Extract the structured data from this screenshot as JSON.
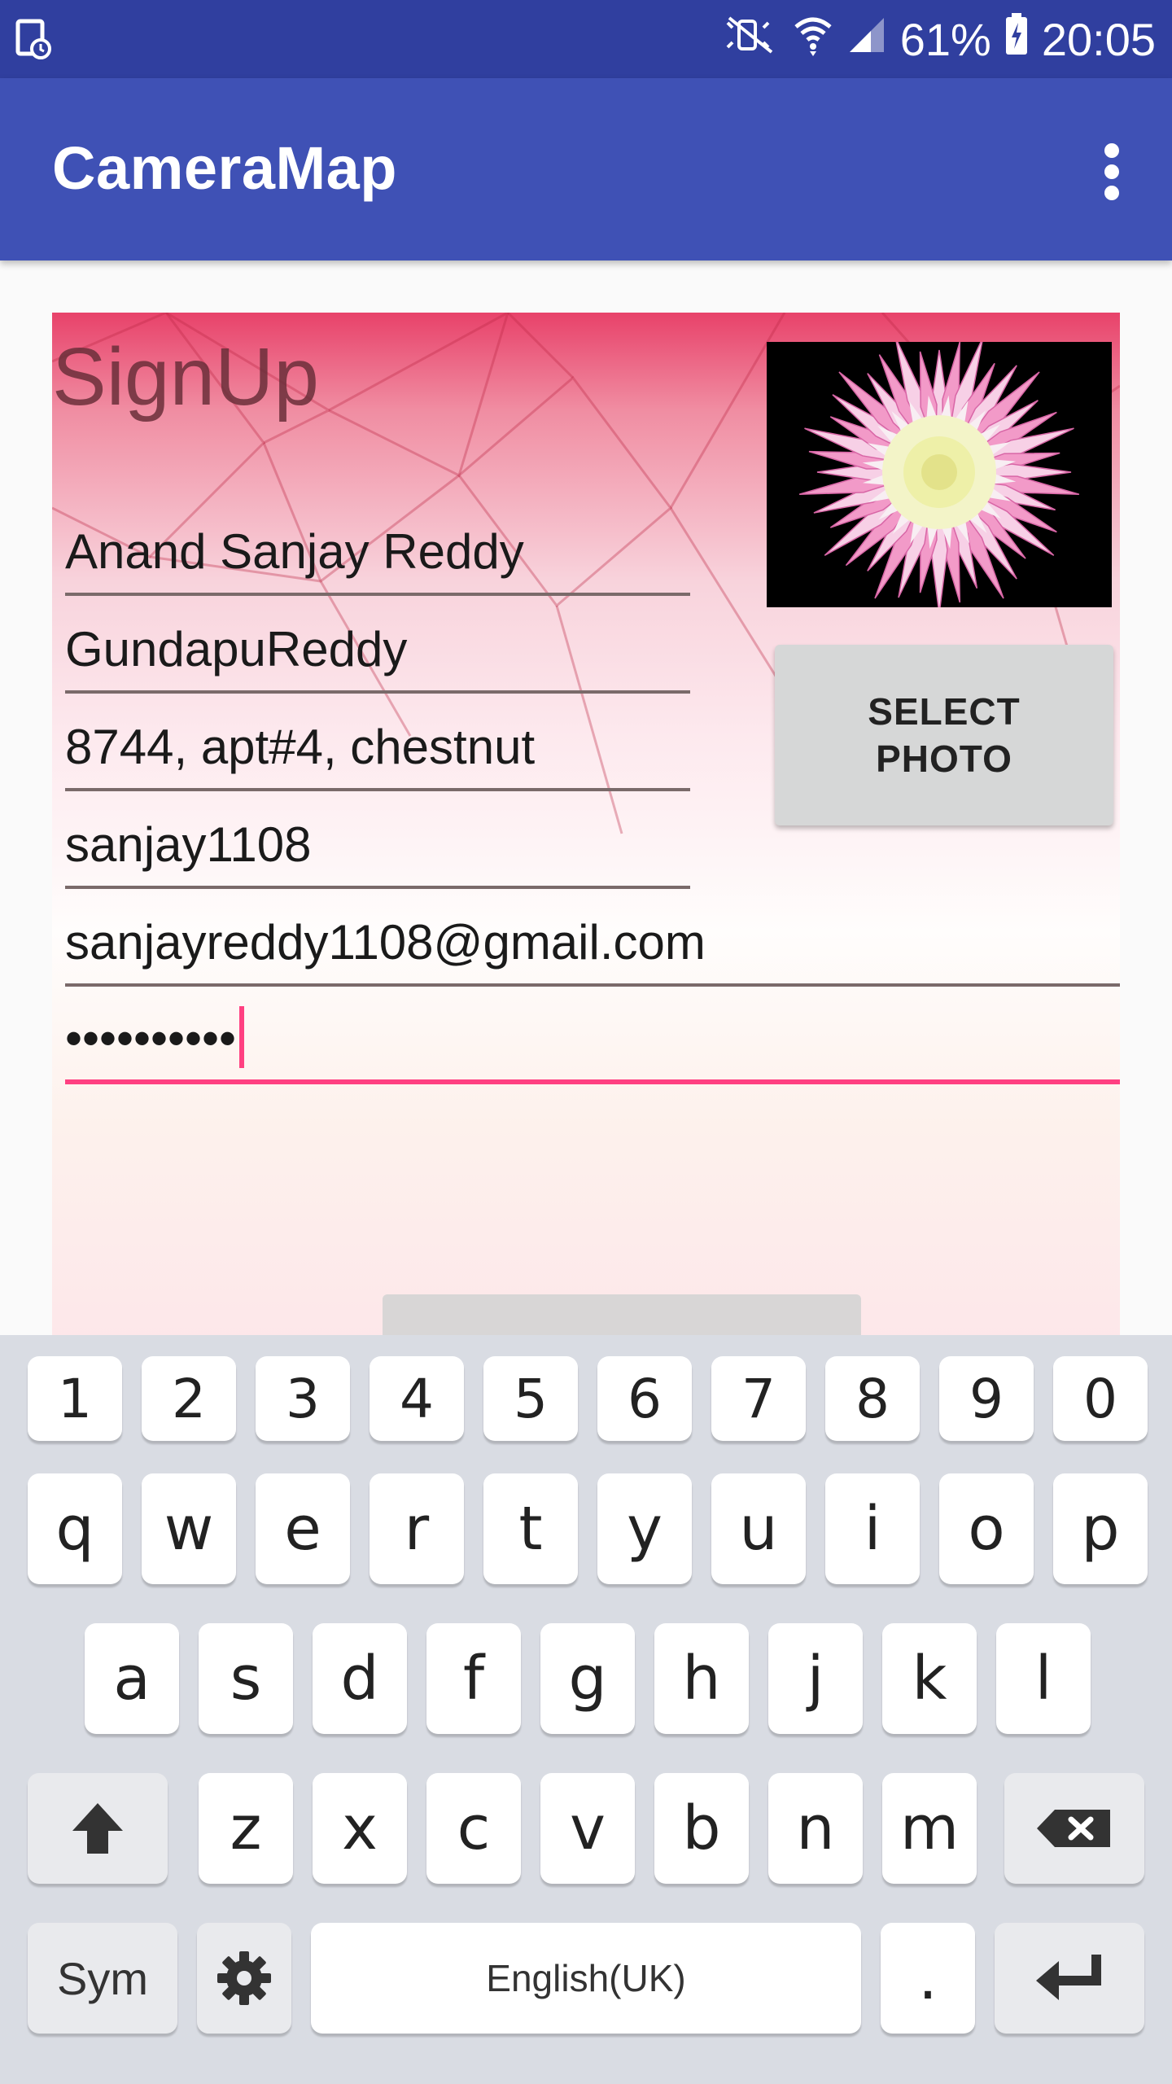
{
  "status_bar": {
    "battery_percent": "61%",
    "time": "20:05",
    "icons": [
      "screenshot-icon",
      "mute-icon",
      "wifi-icon",
      "signal-icon",
      "battery-charging-icon"
    ]
  },
  "app_bar": {
    "title": "CameraMap",
    "menu_icon": "more-vert-icon"
  },
  "form": {
    "heading": "SignUp",
    "fields": [
      {
        "name": "full-name",
        "value": "Anand Sanjay Reddy"
      },
      {
        "name": "last-name",
        "value": "GundapuReddy"
      },
      {
        "name": "address",
        "value": "8744, apt#4, chestnut"
      },
      {
        "name": "username",
        "value": "sanjay1108"
      },
      {
        "name": "email",
        "value": "sanjayreddy1108@gmail.com"
      },
      {
        "name": "password",
        "value": "••••••••••"
      }
    ],
    "select_photo_line1": "SELECT",
    "select_photo_line2": "PHOTO",
    "photo_subject": "pink-white-dahlia-flower"
  },
  "keyboard": {
    "number_row": [
      "1",
      "2",
      "3",
      "4",
      "5",
      "6",
      "7",
      "8",
      "9",
      "0"
    ],
    "row1": [
      "q",
      "w",
      "e",
      "r",
      "t",
      "y",
      "u",
      "i",
      "o",
      "p"
    ],
    "row2": [
      "a",
      "s",
      "d",
      "f",
      "g",
      "h",
      "j",
      "k",
      "l"
    ],
    "row3": [
      "z",
      "x",
      "c",
      "v",
      "b",
      "n",
      "m"
    ],
    "sym_label": "Sym",
    "space_label": "English(UK)",
    "period_label": "."
  },
  "colors": {
    "status_bar": "#303f9f",
    "app_bar": "#3f51b5",
    "accent": "#ff4081",
    "key_bg": "#ffffff",
    "keyboard_bg": "#d9dce3"
  }
}
